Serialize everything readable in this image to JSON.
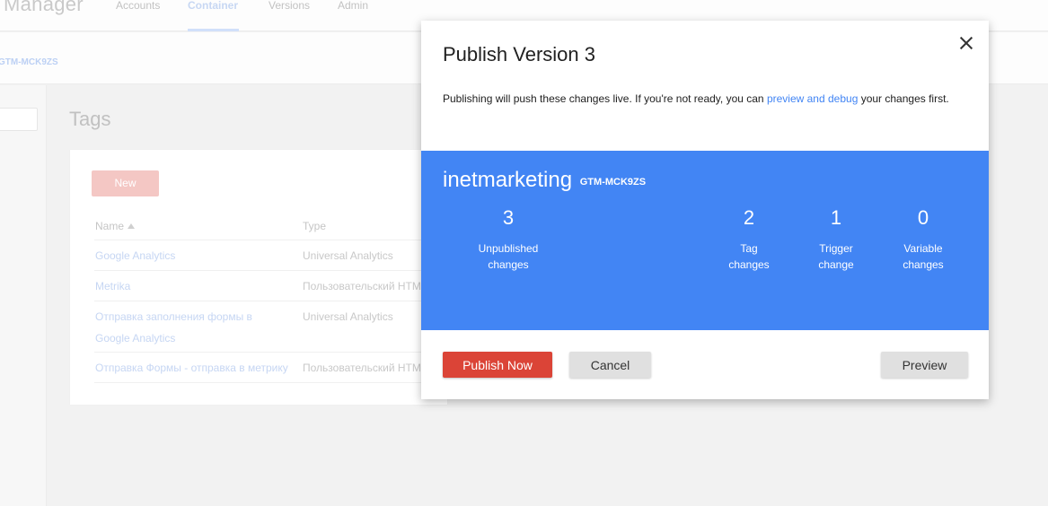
{
  "app": {
    "title": "Manager"
  },
  "nav": {
    "accounts": "Accounts",
    "container": "Container",
    "versions": "Versions",
    "admin": "Admin"
  },
  "subbar": {
    "container_id": "GTM-MCK9ZS"
  },
  "page": {
    "heading": "Tags",
    "new_button": "New"
  },
  "table": {
    "headers": {
      "name": "Name",
      "type": "Type"
    },
    "rows": [
      {
        "name": "Google Analytics",
        "type": "Universal Analytics"
      },
      {
        "name": "Metrika",
        "type": "Пользовательский HTML"
      },
      {
        "name": "Отправка заполнения формы в Google Analytics",
        "type": "Universal Analytics"
      },
      {
        "name": "Отправка Формы - отправка в метрику",
        "type": "Пользовательский HTML"
      }
    ]
  },
  "modal": {
    "title": "Publish Version 3",
    "desc_before": "Publishing will push these changes live. If you're not ready, you can ",
    "desc_link": "preview and debug",
    "desc_after": " your changes first.",
    "container_name": "inetmarketing",
    "container_code": "GTM-MCK9ZS",
    "stats": [
      {
        "value": "3",
        "label_line1": "Unpublished",
        "label_line2": "changes"
      },
      {
        "value": "2",
        "label_line1": "Tag",
        "label_line2": "changes"
      },
      {
        "value": "1",
        "label_line1": "Trigger",
        "label_line2": "change"
      },
      {
        "value": "0",
        "label_line1": "Variable",
        "label_line2": "changes"
      }
    ],
    "buttons": {
      "publish": "Publish Now",
      "cancel": "Cancel",
      "preview": "Preview"
    }
  },
  "colors": {
    "primary_blue": "#4285f4",
    "publish_red": "#db4437",
    "button_gray": "#e0e0e0"
  }
}
